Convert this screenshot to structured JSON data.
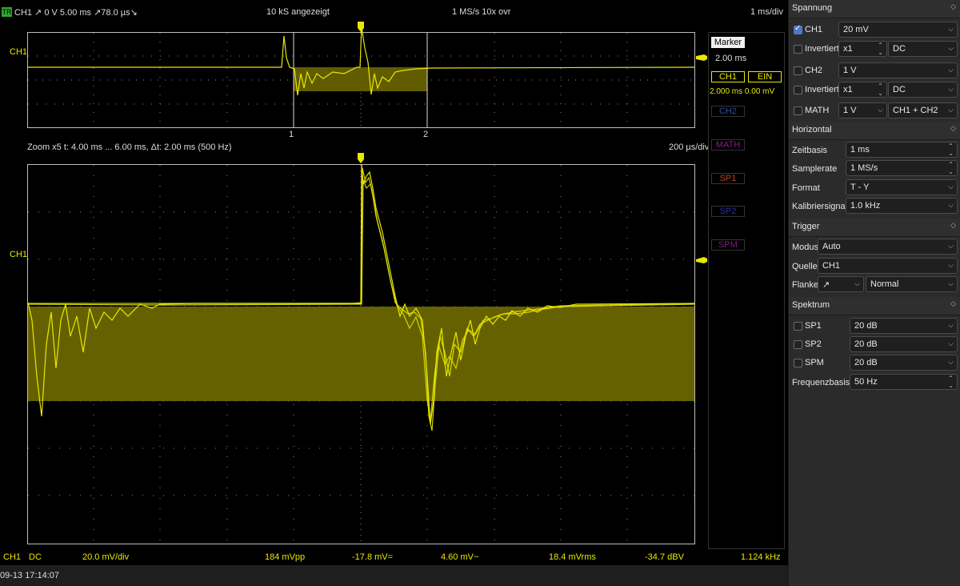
{
  "topbar": {
    "trigger_badge": "TR",
    "trigger_info": "CH1 ↗ 0 V  5.00 ms ↗78.0 µs↘",
    "samples": "10 kS angezeigt",
    "rate": "1 MS/s 10x ovr",
    "timebase": "1 ms/div"
  },
  "overview": {
    "channel_label": "CH1",
    "cursor1": "1",
    "cursor2": "2"
  },
  "zoom": {
    "info": "Zoom x5   t: 4.00 ms ... 6.00 ms,  Δt: 2.00 ms (500 Hz)",
    "scale": "200 µs/div",
    "channel_label": "CH1"
  },
  "side": {
    "marker_title": "Marker",
    "marker_value": "2.00 ms",
    "ch1_btn": "CH1",
    "ein_btn": "EIN",
    "marker_reading": "2.000 ms  0.00 mV",
    "ch2_btn": "CH2",
    "math_btn": "MATH",
    "sp1_btn": "SP1",
    "sp2_btn": "SP2",
    "spm_btn": "SPM"
  },
  "statusbar": {
    "ch": "CH1",
    "coupling": "DC",
    "vdiv": "20.0 mV/div",
    "vpp": "184 mVpp",
    "mean": "-17.8 mV=",
    "ac": "4.60 mV~",
    "rms": "18.4 mVrms",
    "dbv": "-34.7 dBV",
    "freq": "1.124 kHz",
    "datetime": "09-13 17:14:07"
  },
  "panel": {
    "spannung": {
      "title": "Spannung",
      "ch1_label": "CH1",
      "ch1_value": "20 mV",
      "inv1_label": "Invertiert",
      "inv1_probe": "x1",
      "inv1_coupling": "DC",
      "ch2_label": "CH2",
      "ch2_value": "1 V",
      "inv2_label": "Invertiert",
      "inv2_probe": "x1",
      "inv2_coupling": "DC",
      "math_label": "MATH",
      "math_value": "1 V",
      "math_func": "CH1 + CH2"
    },
    "horizontal": {
      "title": "Horizontal",
      "zeitbasis_label": "Zeitbasis",
      "zeitbasis_value": "1 ms",
      "samplerate_label": "Samplerate",
      "samplerate_value": "1 MS/s",
      "format_label": "Format",
      "format_value": "T - Y",
      "kalib_label": "Kalibriersignal",
      "kalib_value": "1.0 kHz"
    },
    "trigger": {
      "title": "Trigger",
      "modus_label": "Modus",
      "modus_value": "Auto",
      "quelle_label": "Quelle",
      "quelle_value": "CH1",
      "flanke_label": "Flanke",
      "flanke_edge": "↗",
      "flanke_value": "Normal"
    },
    "spektrum": {
      "title": "Spektrum",
      "sp1_label": "SP1",
      "sp1_value": "20 dB",
      "sp2_label": "SP2",
      "sp2_value": "20 dB",
      "spm_label": "SPM",
      "spm_value": "20 dB",
      "freqbasis_label": "Frequenzbasis",
      "freqbasis_value": "50 Hz"
    }
  },
  "colors": {
    "trace": "#e8e800",
    "fill": "#6b6600",
    "grid": "#8a8a8a",
    "ch2": "#2c4f9c",
    "math": "#8a1f8a",
    "sp1": "#b04a1a",
    "sp2": "#2a2f9a",
    "spm": "#7a1f7a"
  }
}
